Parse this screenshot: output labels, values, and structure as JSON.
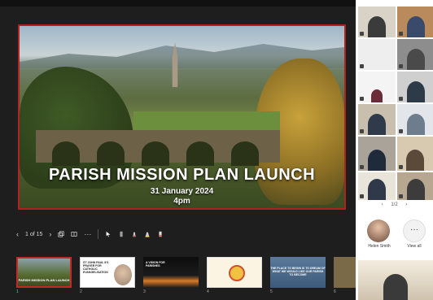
{
  "slide": {
    "title": "PARISH MISSION PLAN LAUNCH",
    "date": "31 January 2024",
    "time": "4pm"
  },
  "toolbar": {
    "page_indicator": "1 of 15"
  },
  "thumbnails": [
    {
      "num": "1",
      "caption": "PARISH MISSION PLAN LAUNCH"
    },
    {
      "num": "2",
      "caption": "ST JOHN PAUL II'S PRAYER FOR CATHOLIC EVANGELISATION"
    },
    {
      "num": "3",
      "caption": "A VISION FOR PARISHES"
    },
    {
      "num": "4",
      "caption": ""
    },
    {
      "num": "5",
      "caption": "THE PLACE TO BEGIN IS TO DREAM OF WHAT WE WOULD LIKE OUR PARISH TO BECOME"
    },
    {
      "num": "6",
      "caption": ""
    }
  ],
  "participants": {
    "pager": "1/2",
    "featured_name": "Helen Smith",
    "view_all_label": "View all"
  },
  "colors": {
    "slide_border": "#c62828",
    "stage_bg": "#1e1e1e",
    "panel_bg": "#ffffff"
  }
}
